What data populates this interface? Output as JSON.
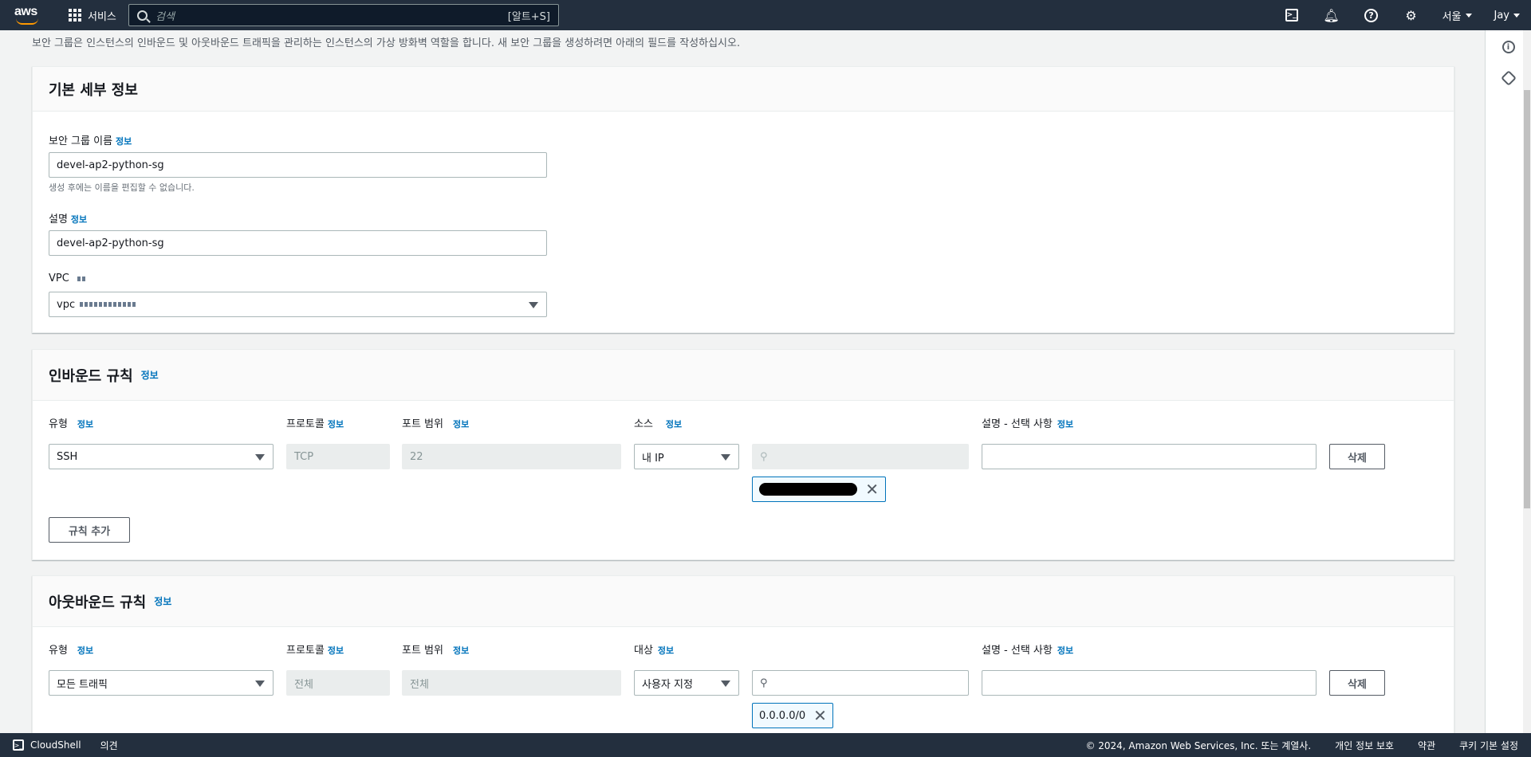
{
  "nav": {
    "logo": "aws",
    "services": "서비스",
    "search_placeholder": "검색",
    "search_shortcut": "[알트+S]",
    "region": "서울",
    "user": "Jay"
  },
  "intro": "보안 그룹은 인스턴스의 인바운드 및 아웃바운드 트래픽을 관리하는 인스턴스의 가상 방화벽 역할을 합니다. 새 보안 그룹을 생성하려면 아래의 필드를 작성하십시오.",
  "basic": {
    "title": "기본 세부 정보",
    "name_label": "보안 그룹 이름",
    "info": "정보",
    "name_value": "devel-ap2-python-sg",
    "name_hint": "생성 후에는 이름을 편집할 수 없습니다.",
    "desc_label": "설명",
    "desc_value": "devel-ap2-python-sg",
    "vpc_label": "VPC",
    "vpc_value": "vpc"
  },
  "inbound": {
    "title": "인바운드 규칙",
    "info": "정보",
    "col_type": "유형",
    "col_protocol": "프로토콜",
    "col_port": "포트 범위",
    "col_source": "소스",
    "col_desc": "설명 - 선택 사항",
    "type_value": "SSH",
    "protocol_value": "TCP",
    "port_value": "22",
    "source_value": "내 IP",
    "delete": "삭제",
    "add_rule": "규칙 추가"
  },
  "outbound": {
    "title": "아웃바운드 규칙",
    "info": "정보",
    "col_type": "유형",
    "col_protocol": "프로토콜",
    "col_port": "포트 범위",
    "col_dest": "대상",
    "col_desc": "설명 - 선택 사항",
    "type_value": "모든 트래픽",
    "protocol_value": "전체",
    "port_value": "전체",
    "dest_value": "사용자 지정",
    "cidr_token": "0.0.0.0/0",
    "delete": "삭제"
  },
  "footer": {
    "cloudshell": "CloudShell",
    "feedback": "의견",
    "copyright": "© 2024, Amazon Web Services, Inc. 또는 계열사.",
    "privacy": "개인 정보 보호",
    "terms": "약관",
    "cookies": "쿠키 기본 설정"
  }
}
